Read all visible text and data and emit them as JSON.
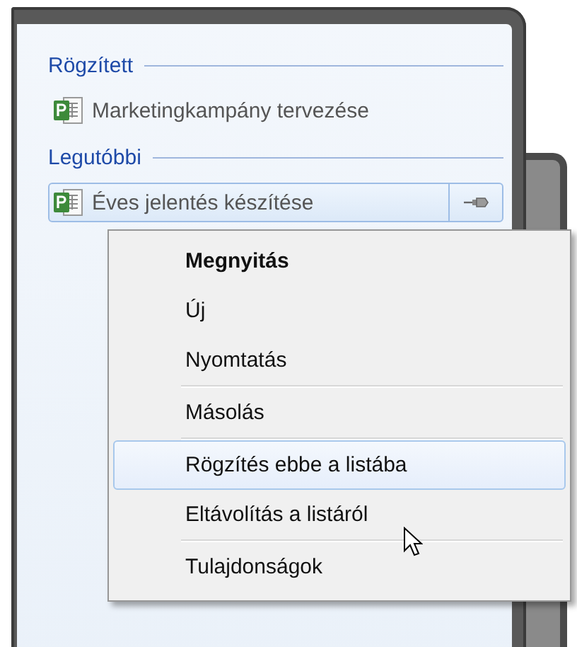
{
  "sections": [
    {
      "heading": "Rögzített",
      "items": [
        {
          "label": "Marketingkampány tervezése",
          "selected": false
        }
      ]
    },
    {
      "heading": "Legutóbbi",
      "items": [
        {
          "label": "Éves jelentés készítése",
          "selected": true
        }
      ]
    }
  ],
  "context_menu": {
    "items": [
      {
        "kind": "item",
        "label": "Megnyitás",
        "default": true,
        "selected": false
      },
      {
        "kind": "item",
        "label": "Új",
        "default": false,
        "selected": false
      },
      {
        "kind": "item",
        "label": "Nyomtatás",
        "default": false,
        "selected": false
      },
      {
        "kind": "separator"
      },
      {
        "kind": "item",
        "label": "Másolás",
        "default": false,
        "selected": false
      },
      {
        "kind": "separator"
      },
      {
        "kind": "item",
        "label": "Rögzítés ebbe a listába",
        "default": false,
        "selected": true
      },
      {
        "kind": "item",
        "label": "Eltávolítás a listáról",
        "default": false,
        "selected": false
      },
      {
        "kind": "separator"
      },
      {
        "kind": "item",
        "label": "Tulajdonságok",
        "default": false,
        "selected": false
      }
    ]
  }
}
